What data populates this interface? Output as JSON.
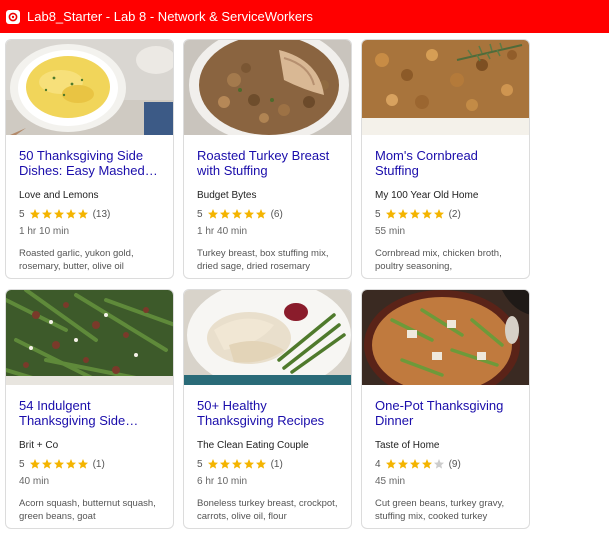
{
  "window": {
    "title": "Lab8_Starter - Lab 8 - Network & ServiceWorkers"
  },
  "colors": {
    "titlebar": "#ff0000",
    "link": "#1a0dab",
    "star_filled": "#f4b400",
    "star_empty": "#cccccc"
  },
  "recipes": [
    {
      "title": "50 Thanksgiving Side Dishes: Easy Mashed…",
      "org": "Love and Lemons",
      "rating": "5",
      "stars": 5,
      "reviews": "(13)",
      "time": "1 hr 10 min",
      "ingredients": "Roasted garlic, yukon gold, rosemary, butter, olive oil",
      "thumb": "mashed-potatoes"
    },
    {
      "title": "Roasted Turkey Breast with Stuffing",
      "org": "Budget Bytes",
      "rating": "5",
      "stars": 5,
      "reviews": "(6)",
      "time": "1 hr 40 min",
      "ingredients": "Turkey breast, box stuffing mix, dried sage, dried rosemary",
      "thumb": "turkey-stuffing"
    },
    {
      "title": "Mom's Cornbread Stuffing",
      "org": "My 100 Year Old Home",
      "rating": "5",
      "stars": 5,
      "reviews": "(2)",
      "time": "55 min",
      "ingredients": "Cornbread mix, chicken broth, poultry seasoning,",
      "thumb": "cornbread-stuffing"
    },
    {
      "title": "54 Indulgent Thanksgiving Side…",
      "org": "Brit + Co",
      "rating": "5",
      "stars": 5,
      "reviews": "(1)",
      "time": "40 min",
      "ingredients": "Acorn squash, butternut squash, green beans, goat",
      "thumb": "green-beans"
    },
    {
      "title": "50+ Healthy Thanksgiving Recipes",
      "org": "The Clean Eating Couple",
      "rating": "5",
      "stars": 5,
      "reviews": "(1)",
      "time": "6 hr 10 min",
      "ingredients": "Boneless turkey breast, crockpot, carrots, olive oil, flour",
      "thumb": "turkey-plate"
    },
    {
      "title": "One-Pot Thanksgiving Dinner",
      "org": "Taste of Home",
      "rating": "4",
      "stars": 4,
      "reviews": "(9)",
      "time": "45 min",
      "ingredients": "Cut green beans, turkey gravy, stuffing mix, cooked turkey",
      "thumb": "one-pot"
    }
  ]
}
